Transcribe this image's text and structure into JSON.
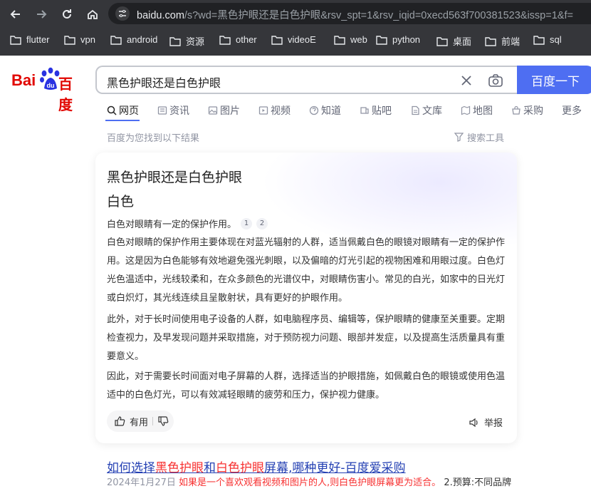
{
  "browser": {
    "url_host": "baidu.com",
    "url_rest": "/s?wd=黑色护眼还是白色护眼&rsv_spt=1&rsv_iqid=0xecd563f700381523&issp=1&f=",
    "bookmarks": [
      "flutter",
      "vpn",
      "android",
      "资源",
      "other",
      "videoE",
      "web",
      "python",
      "桌面",
      "前端",
      "sql"
    ]
  },
  "logo": {
    "part1": "Bai",
    "part2": "百度"
  },
  "search": {
    "query": "黑色护眼还是白色护眼",
    "button_label": "百度一下"
  },
  "tabs": [
    "网页",
    "资讯",
    "图片",
    "视频",
    "知道",
    "贴吧",
    "文库",
    "地图",
    "采购",
    "更多"
  ],
  "result_count": "百度为您找到以下结果",
  "tools_label": "搜索工具",
  "card": {
    "title": "黑色护眼还是白色护眼",
    "answer": "白色",
    "summary": "白色对眼睛有一定的保护作用。",
    "citations": [
      "1",
      "2"
    ],
    "paragraphs": [
      "白色对眼睛的保护作用主要体现在对蓝光辐射的人群，适当佩戴白色的眼镜对眼睛有一定的保护作用。这是因为白色能够有效地避免强光刺眼，以及偏暗的灯光引起的视物困难和用眼过度。白色灯光色温适中，光线较柔和，在众多颜色的光谱仪中，对眼睛伤害小。常见的白光，如家中的日光灯或白炽灯，其光线连续且呈散射状，具有更好的护眼作用。",
      "此外，对于长时间使用电子设备的人群，如电脑程序员、编辑等，保护眼睛的健康至关重要。定期检查视力，及早发现问题并采取措施，对于预防视力问题、眼部并发症，以及提高生活质量具有重要意义。",
      "因此，对于需要长时间面对电子屏幕的人群，选择适当的护眼措施，如佩戴白色的眼镜或使用色温适中的白色灯光，可以有效减轻眼睛的疲劳和压力，保护视力健康。"
    ],
    "helpful_label": "有用",
    "report_label": "举报"
  },
  "result": {
    "title_parts": [
      "如何选择",
      "黑色护眼",
      "和",
      "白色护眼",
      "屏幕,哪种更好-百度爱采购"
    ],
    "date": "2024年1月27日",
    "snippet_hl": "如果是一个喜欢观看视频和图片的人,则白色护眼屏幕更为适合。",
    "snippet_rest": "2.预算:不同品牌"
  }
}
